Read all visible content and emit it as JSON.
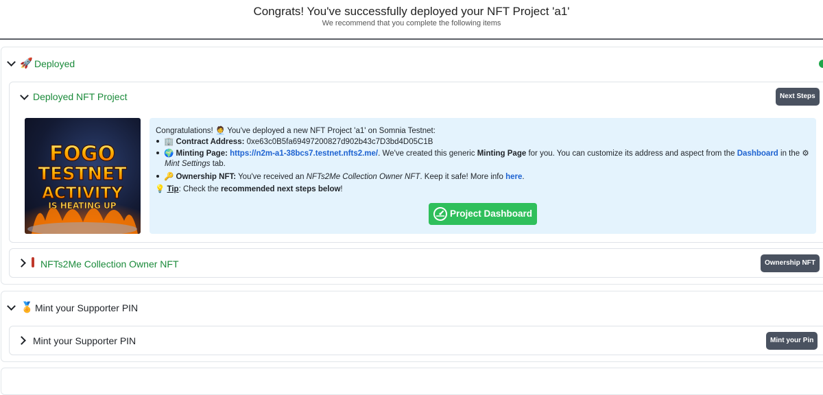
{
  "header": {
    "title": "Congrats! You've successfully deployed your NFT Project 'a1'",
    "subtitle": "We recommend that you complete the following items"
  },
  "deployed_section": {
    "icon": "rocket-icon",
    "title": "Deployed",
    "status_color": "#1fa64a",
    "project_card": {
      "title": "Deployed NFT Project",
      "next_steps_label": "Next Steps",
      "image_text": [
        "FOGO",
        "TESTNET",
        "ACTIVITY",
        "IS HEATING UP"
      ],
      "intro_prefix": "Congratulations!",
      "intro_suffix": "You've deployed a new NFT Project 'a1' on Somnia Testnet:",
      "contract_label": "Contract Address:",
      "contract_value": "0xe63c0B5fa69497200827d902b43c7D3bd4D05C1B",
      "minting_label": "Minting Page:",
      "minting_link": "https://n2m-a1-38bcs7.testnet.nfts2.me/",
      "minting_text_1": ". We've created this generic",
      "minting_bold": "Minting Page",
      "minting_text_2": "for you. You can customize its address and aspect from the",
      "dashboard_link": "Dashboard",
      "minting_text_3": "in the",
      "mint_settings": "Mint Settings",
      "minting_text_4": "tab.",
      "ownership_label": "Ownership NFT:",
      "ownership_text_1": "You've received an",
      "ownership_italic": "NFTs2Me Collection Owner NFT",
      "ownership_text_2": ". Keep it safe! More info",
      "ownership_link": "here",
      "ownership_dot": ".",
      "tip_label": "Tip",
      "tip_text_1": ": Check the",
      "tip_bold": "recommended next steps below",
      "tip_text_2": "!",
      "dashboard_button": "Project Dashboard"
    },
    "owner_card": {
      "title": "NFTs2Me Collection Owner NFT",
      "button": "Ownership NFT"
    }
  },
  "supporter_section": {
    "icon": "medal-icon",
    "title": "Mint your Supporter PIN",
    "inner_title": "Mint your Supporter PIN",
    "button": "Mint your Pin"
  },
  "colors": {
    "accent_green": "#1a8a3a",
    "button_green": "#2fbf5b",
    "dark_button": "#4a5260",
    "link_blue": "#1d62d1",
    "panel_bg": "#e4f3fd"
  }
}
